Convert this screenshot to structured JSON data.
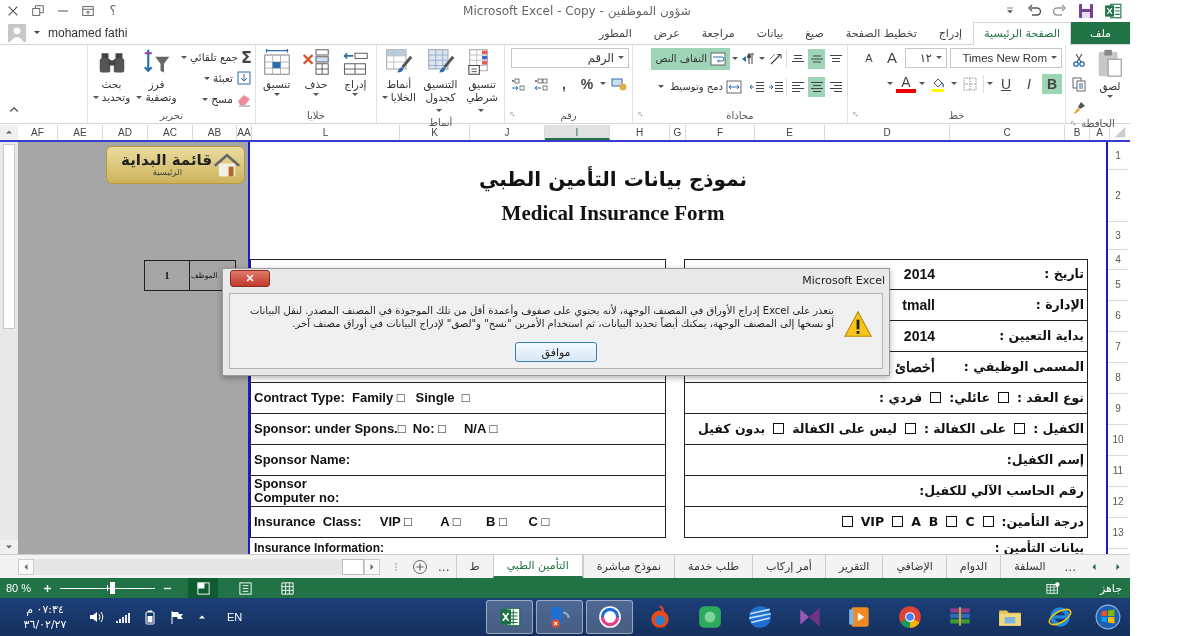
{
  "window": {
    "title": "Microsoft Excel - Copy - شؤون الموظفين",
    "help": "؟",
    "user": "mohamed fathi"
  },
  "ribbon_tabs": [
    {
      "label": "ملف",
      "kind": "file",
      "selected": false
    },
    {
      "label": "الصفحة الرئيسية",
      "kind": "tab",
      "selected": true
    },
    {
      "label": "إدراج",
      "kind": "tab",
      "selected": false
    },
    {
      "label": "تخطيط الصفحة",
      "kind": "tab",
      "selected": false
    },
    {
      "label": "صيغ",
      "kind": "tab",
      "selected": false
    },
    {
      "label": "بيانات",
      "kind": "tab",
      "selected": false
    },
    {
      "label": "مراجعة",
      "kind": "tab",
      "selected": false
    },
    {
      "label": "عرض",
      "kind": "tab",
      "selected": false
    },
    {
      "label": "المطور",
      "kind": "tab",
      "selected": false
    }
  ],
  "ribbon": {
    "clipboard": {
      "label": "الحافظة",
      "paste": "لصق"
    },
    "font": {
      "label": "خط",
      "font_name": "Times New Rom",
      "font_size": "١٢",
      "grow": "A",
      "shrink": "A",
      "font_color": "A",
      "styles": [
        {
          "label": "B",
          "on": true
        },
        {
          "label": "I",
          "on": false
        },
        {
          "label": "U",
          "on": false
        }
      ]
    },
    "alignment": {
      "label": "محاذاة",
      "vertical": [
        {
          "on": false
        },
        {
          "on": true
        },
        {
          "on": false
        }
      ],
      "horizontal": [
        {
          "on": false
        },
        {
          "on": true
        },
        {
          "on": false
        }
      ],
      "wrap": {
        "label": "التفاف النص",
        "on": true
      },
      "merge": "دمج وتوسيط"
    },
    "number": {
      "label": "رقم",
      "format": "الرقم",
      "percent": "%",
      "comma": ","
    },
    "styles": {
      "label": "أنماط",
      "buttons": [
        "تنسيق شرطي",
        "التنسيق كجدول",
        "أنماط الخلايا"
      ]
    },
    "cells": {
      "label": "خلايا",
      "buttons": [
        "إدراج",
        "حذف",
        "تنسيق"
      ]
    },
    "editing": {
      "label": "تحرير",
      "autosum_symbol": "Σ",
      "small": [
        "جمع تلقائي",
        "تعبئة",
        "مسح"
      ],
      "buttons": [
        "فرز وتصفية",
        "بحث وتحديد"
      ]
    }
  },
  "columns": [
    {
      "label": "A",
      "selected": false
    },
    {
      "label": "B",
      "selected": false
    },
    {
      "label": "C",
      "selected": false
    },
    {
      "label": "D",
      "selected": false
    },
    {
      "label": "E",
      "selected": false
    },
    {
      "label": "F",
      "selected": false
    },
    {
      "label": "G",
      "selected": false
    },
    {
      "label": "H",
      "selected": false
    },
    {
      "label": "I",
      "selected": true
    },
    {
      "label": "J",
      "selected": false
    },
    {
      "label": "K",
      "selected": false
    },
    {
      "label": "L",
      "selected": false
    },
    {
      "label": "AA",
      "selected": false
    },
    {
      "label": "AB",
      "selected": false
    },
    {
      "label": "AC",
      "selected": false
    },
    {
      "label": "AD",
      "selected": false
    },
    {
      "label": "AE",
      "selected": false
    },
    {
      "label": "AF",
      "selected": false
    }
  ],
  "rows": [
    "1",
    "2",
    "3",
    "4",
    "5",
    "6",
    "7",
    "8",
    "9",
    "10",
    "11",
    "12",
    "13"
  ],
  "start_button": {
    "title": "قائمة البداية",
    "subtitle": "الرئيسية"
  },
  "employee_box": {
    "label": "الموظف",
    "value": "1"
  },
  "form": {
    "title_ar": "نموذج بيانات التأمين الطبي",
    "title_en": "Medical Insurance Form",
    "english_rows": [
      "Contract Type:  Family □   Single  □",
      "Sponsor: under Spons.□  No: □     N/A □",
      "Sponsor Name:",
      "Sponsor\nComputer no:",
      "Insurance  Class:     VIP □        A □       B □      C □"
    ],
    "arabic_rows": [
      {
        "parts": [
          {
            "kind": "text",
            "text": "تاريخ :"
          }
        ],
        "value": "2014"
      },
      {
        "parts": [
          {
            "kind": "text",
            "text": "الإدارة :"
          }
        ],
        "value": "tmall"
      },
      {
        "parts": [
          {
            "kind": "text",
            "text": "بداية التعيين :"
          }
        ],
        "value": "2014"
      },
      {
        "parts": [
          {
            "kind": "text",
            "text": "المسمى الوظيفي :"
          }
        ],
        "value": "أخصائ"
      },
      {
        "parts": [
          {
            "kind": "text",
            "text": "نوع العقد :"
          },
          {
            "kind": "checkbox",
            "checked": false
          },
          {
            "kind": "text",
            "text": "عائلي:"
          },
          {
            "kind": "checkbox",
            "checked": false
          },
          {
            "kind": "text",
            "text": "فردي :"
          }
        ]
      },
      {
        "parts": [
          {
            "kind": "text",
            "text": "الكفيل :"
          },
          {
            "kind": "checkbox",
            "checked": false
          },
          {
            "kind": "text",
            "text": "على الكفالة :"
          },
          {
            "kind": "checkbox",
            "checked": false
          },
          {
            "kind": "text",
            "text": "ليس على الكفالة"
          },
          {
            "kind": "checkbox",
            "checked": false
          },
          {
            "kind": "text",
            "text": "بدون كفيل"
          }
        ]
      },
      {
        "parts": [
          {
            "kind": "text",
            "text": "إسم الكفيل:"
          }
        ]
      },
      {
        "parts": [
          {
            "kind": "text",
            "text": "رقم الحاسب الآلي للكفيل:"
          }
        ]
      },
      {
        "parts": [
          {
            "kind": "text",
            "text": "درجة التأمين:"
          },
          {
            "kind": "checkbox",
            "checked": false
          },
          {
            "kind": "text",
            "text": "C"
          },
          {
            "kind": "checkbox",
            "checked": false
          },
          {
            "kind": "text",
            "text": "B"
          },
          {
            "kind": "text",
            "text": "A"
          },
          {
            "kind": "checkbox",
            "checked": false
          },
          {
            "kind": "text",
            "text": "VIP"
          },
          {
            "kind": "checkbox",
            "checked": false
          }
        ]
      }
    ],
    "english_footer": "Insurance Information:",
    "arabic_footer": "بيانات التأمين :"
  },
  "dialog": {
    "title": "Microsoft Excel",
    "message": "يتعذر على Excel إدراج الأوراق في المصنف الوجهة، لأنه يحتوي على صفوف وأعمدة أقل من تلك الموجودة في المصنف المصدر. لنقل البيانات أو نسخها إلى المصنف الوجهة، يمكنك أيضاً تحديد البيانات، ثم استخدام الأمرين \"نسخ\" و\"لصق\" لإدراج البيانات في أوراق مصنف آخر.",
    "button": "موافق"
  },
  "sheet_tabs": {
    "more_left": "...",
    "more_right": "...",
    "tabs": [
      {
        "label": "السلفة",
        "selected": false
      },
      {
        "label": "الدوام",
        "selected": false
      },
      {
        "label": "الإضافي",
        "selected": false
      },
      {
        "label": "التقرير",
        "selected": false
      },
      {
        "label": "أمر إركاب",
        "selected": false
      },
      {
        "label": "طلب خدمة",
        "selected": false
      },
      {
        "label": "نموذج مباشرة",
        "selected": false
      },
      {
        "label": "التأمين الطبي",
        "selected": true
      },
      {
        "label": "ط",
        "selected": false
      }
    ]
  },
  "status": {
    "ready": "جاهز",
    "zoom": "80 %",
    "zoom_slider": {
      "level": 0.55
    },
    "views": [
      {
        "selected": true
      },
      {
        "selected": false
      },
      {
        "selected": false
      }
    ]
  },
  "taskbar": {
    "time": "٠٧:٣٤ م",
    "date": "٣٦/٠٢/٢٧",
    "language": "EN",
    "apps": [
      {
        "kind": "start",
        "running": false
      },
      {
        "kind": "ie",
        "running": false
      },
      {
        "kind": "folder",
        "running": false
      },
      {
        "kind": "books",
        "running": false
      },
      {
        "kind": "ball",
        "running": false
      },
      {
        "kind": "player",
        "running": false
      },
      {
        "kind": "bowtie",
        "running": false
      },
      {
        "kind": "globe",
        "running": false
      },
      {
        "kind": "square",
        "running": false
      },
      {
        "kind": "flame",
        "running": false
      },
      {
        "kind": "swirl",
        "running": true
      },
      {
        "kind": "mail",
        "running": true
      },
      {
        "kind": "sheet",
        "running": true
      }
    ]
  }
}
